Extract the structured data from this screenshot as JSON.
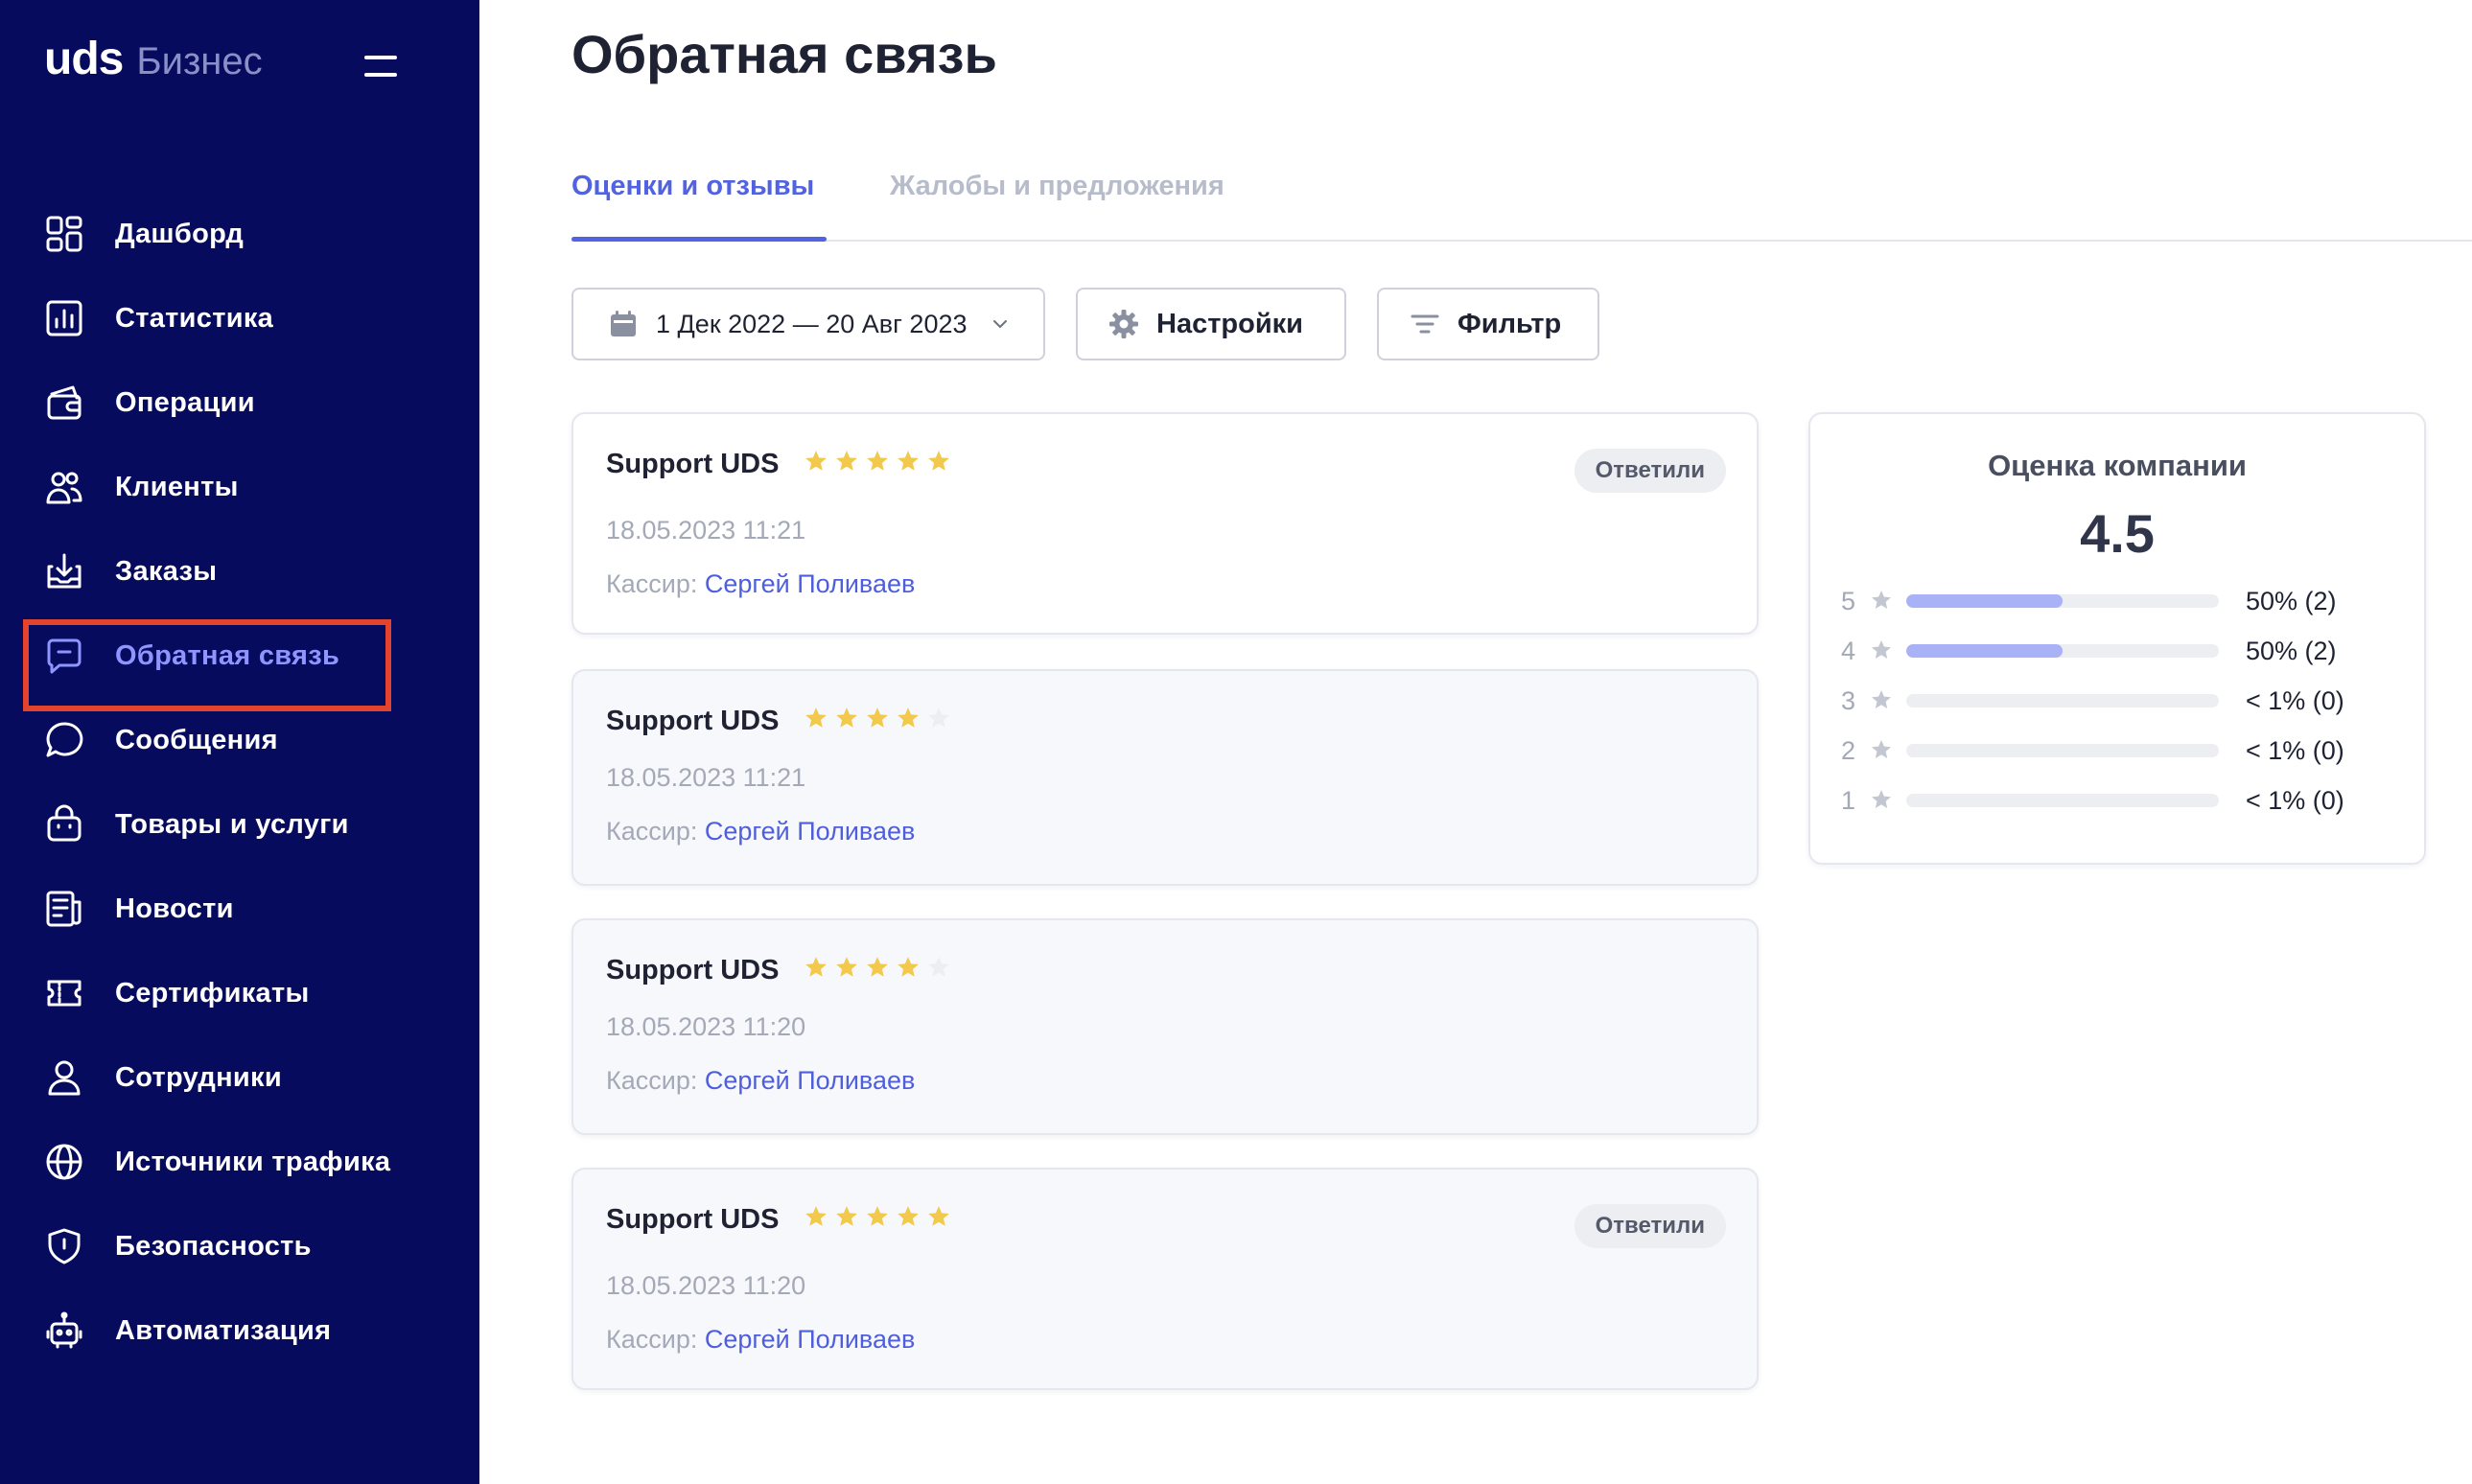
{
  "brand": {
    "logo": "uds",
    "subtitle": "Бизнес"
  },
  "nav": [
    {
      "label": "Дашборд",
      "icon": "dashboard-icon"
    },
    {
      "label": "Статистика",
      "icon": "chart-icon"
    },
    {
      "label": "Операции",
      "icon": "operations-icon"
    },
    {
      "label": "Клиенты",
      "icon": "users-icon"
    },
    {
      "label": "Заказы",
      "icon": "inbox-icon"
    },
    {
      "label": "Обратная связь",
      "icon": "feedback-icon",
      "active": true
    },
    {
      "label": "Сообщения",
      "icon": "message-icon"
    },
    {
      "label": "Товары и услуги",
      "icon": "bag-icon"
    },
    {
      "label": "Новости",
      "icon": "news-icon"
    },
    {
      "label": "Сертификаты",
      "icon": "ticket-icon"
    },
    {
      "label": "Сотрудники",
      "icon": "person-icon"
    },
    {
      "label": "Источники трафика",
      "icon": "globe-icon"
    },
    {
      "label": "Безопасность",
      "icon": "shield-icon"
    },
    {
      "label": "Автоматизация",
      "icon": "robot-icon"
    }
  ],
  "page": {
    "title": "Обратная связь"
  },
  "tabs": [
    {
      "label": "Оценки и отзывы",
      "active": true
    },
    {
      "label": "Жалобы и предложения",
      "active": false
    }
  ],
  "toolbar": {
    "date_range": "1 Дек 2022 — 20 Авг 2023",
    "settings_label": "Настройки",
    "filter_label": "Фильтр"
  },
  "reviews": [
    {
      "author": "Support UDS",
      "stars": 5,
      "date": "18.05.2023 11:21",
      "cashier_label": "Кассир:",
      "cashier_name": "Сергей Поливаев",
      "badge": "Ответили"
    },
    {
      "author": "Support UDS",
      "stars": 4,
      "date": "18.05.2023 11:21",
      "cashier_label": "Кассир:",
      "cashier_name": "Сергей Поливаев",
      "badge": ""
    },
    {
      "author": "Support UDS",
      "stars": 4,
      "date": "18.05.2023 11:20",
      "cashier_label": "Кассир:",
      "cashier_name": "Сергей Поливаев",
      "badge": ""
    },
    {
      "author": "Support UDS",
      "stars": 5,
      "date": "18.05.2023 11:20",
      "cashier_label": "Кассир:",
      "cashier_name": "Сергей Поливаев",
      "badge": "Ответили"
    }
  ],
  "rating": {
    "title": "Оценка компании",
    "score": "4.5",
    "rows": [
      {
        "stars": "5",
        "percent_text": "50% (2)",
        "fraction": 0.5
      },
      {
        "stars": "4",
        "percent_text": "50% (2)",
        "fraction": 0.5
      },
      {
        "stars": "3",
        "percent_text": "< 1% (0)",
        "fraction": 0
      },
      {
        "stars": "2",
        "percent_text": "< 1% (0)",
        "fraction": 0
      },
      {
        "stars": "1",
        "percent_text": "< 1% (0)",
        "fraction": 0
      }
    ]
  },
  "colors": {
    "sidebar_bg": "#070b5e",
    "accent": "#5162e3",
    "star_filled": "#f2c94c",
    "star_empty": "#eceef2",
    "highlight_box": "#e2442c"
  }
}
